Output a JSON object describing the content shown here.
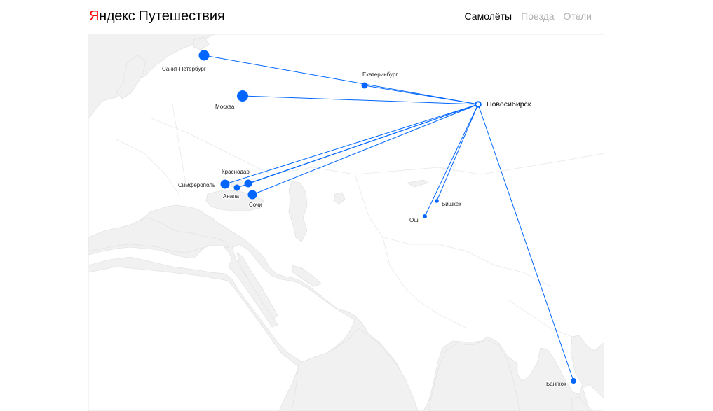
{
  "header": {
    "logo_brand_first": "Я",
    "logo_brand_rest": "ндекс",
    "logo_service": "Путешествия",
    "nav": [
      {
        "label": "Самолёты",
        "active": true
      },
      {
        "label": "Поезда",
        "active": false
      },
      {
        "label": "Отели",
        "active": false
      }
    ]
  },
  "colors": {
    "route": "#0066ff",
    "land": "#ffffff",
    "water": "#f1f1f1",
    "active_nav": "#000000",
    "inactive_nav": "#b0b0b0",
    "logo_accent": "#ff0000"
  },
  "map": {
    "origin": {
      "name": "Новосибирск"
    },
    "destinations": [
      {
        "name": "Санкт-Петербург"
      },
      {
        "name": "Москва"
      },
      {
        "name": "Екатеринбург"
      },
      {
        "name": "Краснодар"
      },
      {
        "name": "Симферополь"
      },
      {
        "name": "Анапа"
      },
      {
        "name": "Сочи"
      },
      {
        "name": "Бишкек"
      },
      {
        "name": "Ош"
      },
      {
        "name": "Бангкок"
      }
    ]
  }
}
